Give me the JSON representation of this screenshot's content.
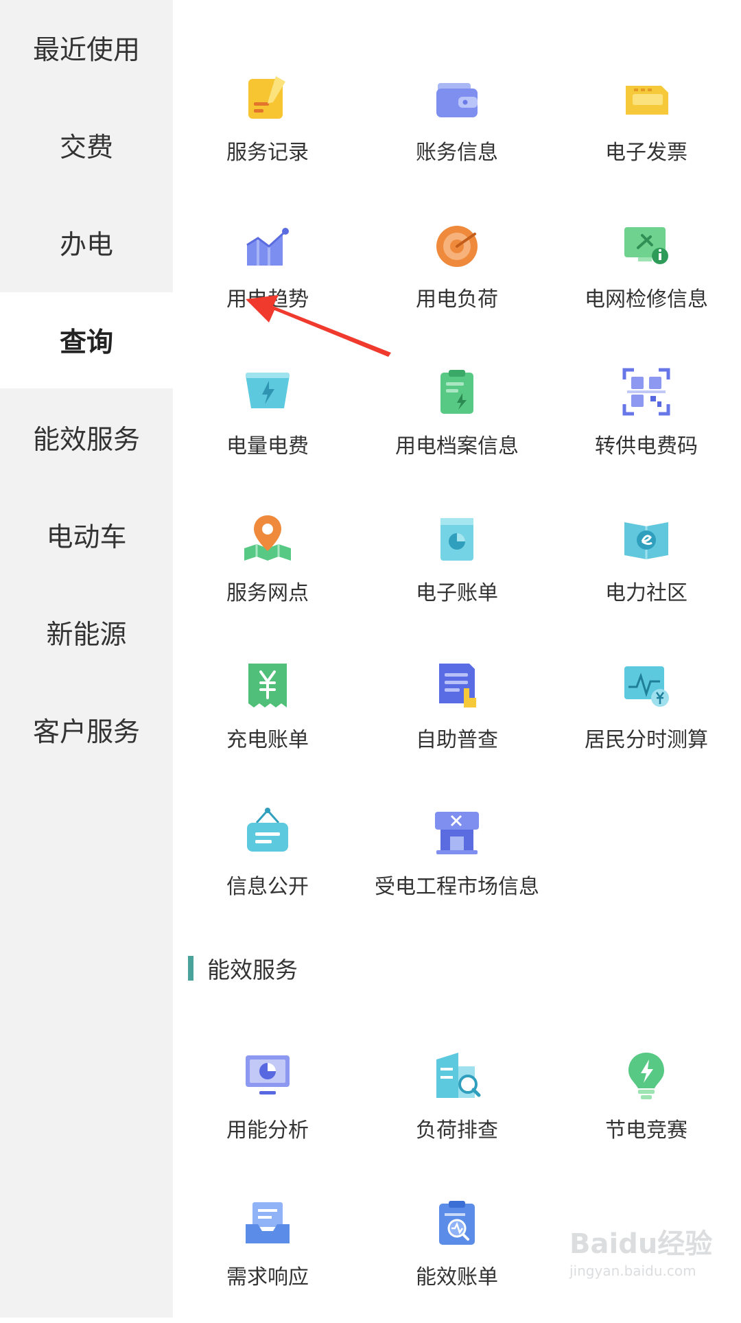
{
  "sidebar": {
    "items": [
      {
        "label": "最近使用",
        "active": false
      },
      {
        "label": "交费",
        "active": false
      },
      {
        "label": "办电",
        "active": false
      },
      {
        "label": "查询",
        "active": true
      },
      {
        "label": "能效服务",
        "active": false
      },
      {
        "label": "电动车",
        "active": false
      },
      {
        "label": "新能源",
        "active": false
      },
      {
        "label": "客户服务",
        "active": false
      }
    ]
  },
  "query": {
    "items": [
      {
        "label": "服务记录",
        "icon": "note-pencil-icon"
      },
      {
        "label": "账务信息",
        "icon": "wallet-icon"
      },
      {
        "label": "电子发票",
        "icon": "invoice-icon"
      },
      {
        "label": "用电趋势",
        "icon": "trend-chart-icon"
      },
      {
        "label": "用电负荷",
        "icon": "gauge-icon"
      },
      {
        "label": "电网检修信息",
        "icon": "monitor-plug-info-icon"
      },
      {
        "label": "电量电费",
        "icon": "battery-bolt-icon"
      },
      {
        "label": "用电档案信息",
        "icon": "clipboard-bolt-icon"
      },
      {
        "label": "转供电费码",
        "icon": "qr-code-icon"
      },
      {
        "label": "服务网点",
        "icon": "map-pin-icon"
      },
      {
        "label": "电子账单",
        "icon": "bill-pie-icon"
      },
      {
        "label": "电力社区",
        "icon": "book-community-icon"
      },
      {
        "label": "充电账单",
        "icon": "yuan-receipt-icon"
      },
      {
        "label": "自助普查",
        "icon": "document-hand-icon"
      },
      {
        "label": "居民分时测算",
        "icon": "chart-yuan-icon"
      },
      {
        "label": "信息公开",
        "icon": "hanging-sign-icon"
      },
      {
        "label": "受电工程市场信息",
        "icon": "storefront-tools-icon"
      }
    ]
  },
  "efficiency": {
    "title": "能效服务",
    "items": [
      {
        "label": "用能分析",
        "icon": "monitor-pie-icon"
      },
      {
        "label": "负荷排查",
        "icon": "building-search-icon"
      },
      {
        "label": "节电竞赛",
        "icon": "lightbulb-bolt-icon"
      },
      {
        "label": "需求响应",
        "icon": "inbox-tray-icon"
      },
      {
        "label": "能效账单",
        "icon": "clipboard-search-icon"
      }
    ]
  },
  "watermark": {
    "logo": "Baidu经验",
    "url": "jingyan.baidu.com"
  },
  "colors": {
    "sidebar_bg": "#f2f2f2",
    "accent_green": "#4aa39b",
    "arrow_red": "#f03a2e"
  }
}
